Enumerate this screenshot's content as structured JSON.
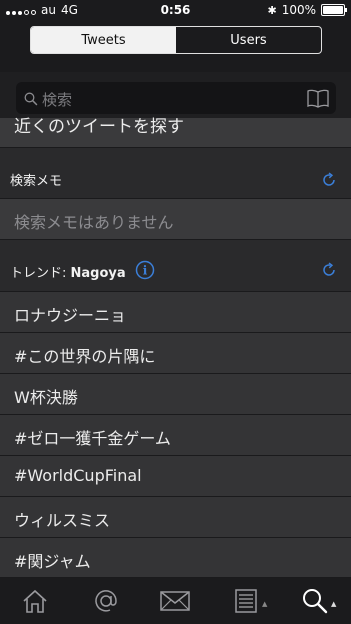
{
  "status": {
    "carrier": "au",
    "network": "4G",
    "time": "0:56",
    "battery": "100%"
  },
  "header": {
    "segments": [
      "Tweets",
      "Users"
    ],
    "selected": "Tweets"
  },
  "search": {
    "placeholder": "検索"
  },
  "nearby_label": "近くのツイートを探す",
  "memo": {
    "title": "検索メモ",
    "empty_text": "検索メモはありません"
  },
  "trends": {
    "title_prefix": "トレンド: ",
    "location": "Nagoya",
    "items": [
      "ロナウジーニョ",
      "#この世界の片隅に",
      "W杯決勝",
      "#ゼロ一獲千金ゲーム",
      "#WorldCupFinal",
      "ウィルスミス",
      "#関ジャム"
    ]
  },
  "colors": {
    "accent": "#3b7fd9",
    "background": "#2a2a2c",
    "bar": "#1b1b1d"
  },
  "tabs": [
    {
      "icon": "home-icon"
    },
    {
      "icon": "mention-icon"
    },
    {
      "icon": "messages-icon"
    },
    {
      "icon": "lists-icon"
    },
    {
      "icon": "search-icon",
      "active": true
    }
  ]
}
